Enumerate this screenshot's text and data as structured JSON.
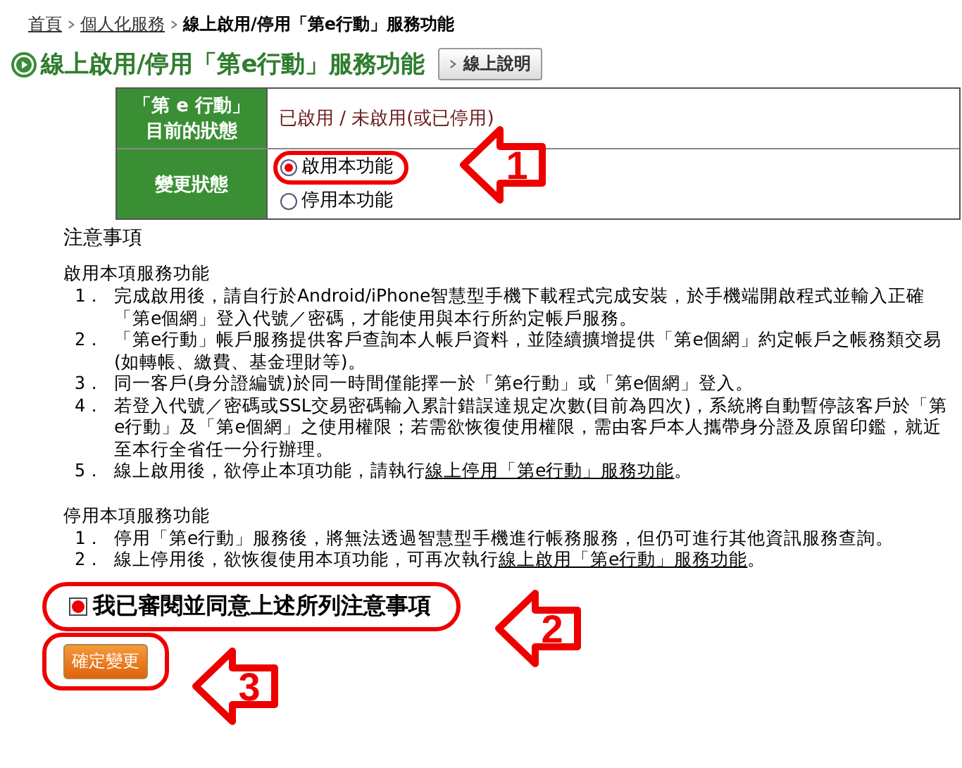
{
  "breadcrumb": [
    {
      "text": "首頁",
      "link": true
    },
    {
      "text": "個人化服務",
      "link": true
    },
    {
      "text": "線上啟用/停用「第e行動」服務功能",
      "link": false
    }
  ],
  "title": "線上啟用/停用「第e行動」服務功能",
  "help_button": "線上說明",
  "status_table": [
    {
      "kind": "text",
      "label": "「第 e 行動」目前的狀態",
      "value": "已啟用 / 未啟用(或已停用)"
    },
    {
      "kind": "radio",
      "label": "變更狀態",
      "options": [
        {
          "label": "啟用本功能",
          "selected": true,
          "highlighted": true
        },
        {
          "label": "停用本功能",
          "selected": false,
          "highlighted": false
        }
      ]
    }
  ],
  "notes_heading": "注意事項",
  "sections": [
    {
      "heading": "啟用本項服務功能",
      "items": [
        {
          "number": "1．",
          "text": "完成啟用後，請自行於Android/iPhone智慧型手機下載程式完成安裝，於手機端開啟程式並輸入正確「第e個網」登入代號／密碼，才能使用與本行所約定帳戶服務。"
        },
        {
          "number": "2．",
          "text": "「第e行動」帳戶服務提供客戶查詢本人帳戶資料，並陸續擴增提供「第e個網」約定帳戶之帳務類交易(如轉帳、繳費、基金理財等)。"
        },
        {
          "number": "3．",
          "text": "同一客戶(身分證編號)於同一時間僅能擇一於「第e行動」或「第e個網」登入。"
        },
        {
          "number": "4．",
          "text": "若登入代號／密碼或SSL交易密碼輸入累計錯誤達規定次數(目前為四次)，系統將自動暫停該客戶於「第e行動」及「第e個網」之使用權限；若需欲恢復使用權限，需由客戶本人攜帶身分證及原留印鑑，就近至本行全省任一分行辦理。"
        },
        {
          "number": "5．",
          "text": "線上啟用後，欲停止本項功能，請執行",
          "link": "線上停用「第e行動」服務功能",
          "tail": "。"
        }
      ]
    },
    {
      "heading": "停用本項服務功能",
      "items": [
        {
          "number": "1．",
          "text": "停用「第e行動」服務後，將無法透過智慧型手機進行帳務服務，但仍可進行其他資訊服務查詢。"
        },
        {
          "number": "2．",
          "text": "線上停用後，欲恢復使用本項功能，可再次執行",
          "link": "線上啟用「第e行動」服務功能",
          "tail": "。"
        }
      ]
    }
  ],
  "agreement": {
    "label": "我已審閱並同意上述所列注意事項",
    "checked": true,
    "highlighted": true
  },
  "submit_button": {
    "label": "確定變更",
    "highlighted": true
  },
  "callouts": [
    {
      "number": "1"
    },
    {
      "number": "2"
    },
    {
      "number": "3"
    }
  ]
}
